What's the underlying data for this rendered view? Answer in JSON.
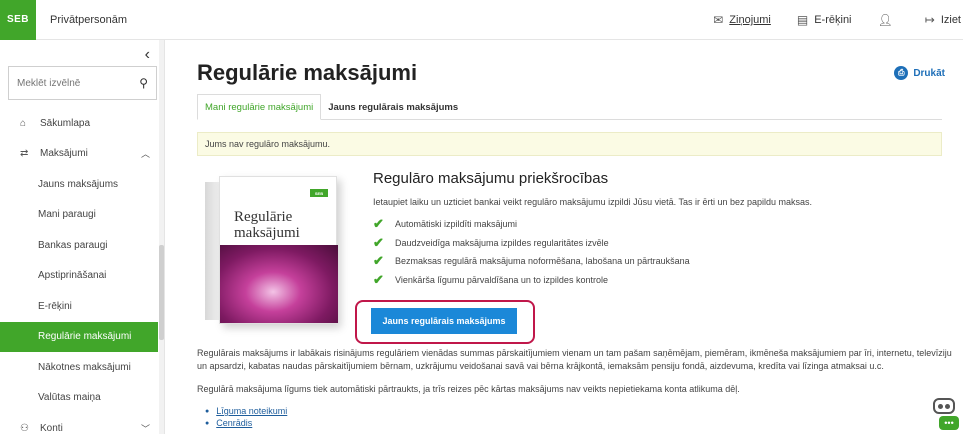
{
  "header": {
    "logo": "SEB",
    "section": "Privātpersonām",
    "messages_label": "Ziņojumi",
    "einvoices_label": "E-rēķini",
    "logout_label": "Iziet"
  },
  "sidebar": {
    "collapse_glyph": "‹",
    "search_placeholder": "Meklēt izvēlnē",
    "items": [
      {
        "label": "Sākumlapa"
      },
      {
        "label": "Maksājumi"
      },
      {
        "label": "Jauns maksājums"
      },
      {
        "label": "Mani paraugi"
      },
      {
        "label": "Bankas paraugi"
      },
      {
        "label": "Apstiprināšanai"
      },
      {
        "label": "E-rēķini"
      },
      {
        "label": "Regulārie maksājumi"
      },
      {
        "label": "Nākotnes maksājumi"
      },
      {
        "label": "Valūtas maiņa"
      },
      {
        "label": "Konti"
      }
    ]
  },
  "main": {
    "title": "Regulārie maksājumi",
    "print_label": "Drukāt",
    "tabs": [
      {
        "label": "Mani regulārie maksājumi"
      },
      {
        "label": "Jauns regulārais maksājums"
      }
    ],
    "notice": "Jums nav regulāro maksājumu.",
    "product_box_title_line1": "Regulārie",
    "product_box_title_line2": "maksājumi",
    "product_box_badge": "SEB",
    "features_title": "Regulāro maksājumu priekšrocības",
    "features_desc": "Ietaupiet laiku un uzticiet bankai veikt regulāro maksājumu izpildi Jūsu vietā. Tas ir ērti un bez papildu maksas.",
    "features": [
      "Automātiski izpildīti maksājumi",
      "Daudzveidīga maksājuma izpildes regularitātes izvēle",
      "Bezmaksas regulārā maksājuma noformēšana, labošana un pārtraukšana",
      "Vienkārša līgumu pārvaldīšana un to izpildes kontrole"
    ],
    "cta_label": "Jauns regulārais maksājums",
    "paragraph1": "Regulārais maksājums ir labākais risinājums regulāriem vienādas summas pārskaitījumiem vienam un tam pašam saņēmējam, piemēram, ikmēneša maksājumiem par īri, internetu, televīziju un apsardzi, kabatas naudas pārskaitījumiem bērnam, uzkrājumu veidošanai savā vai bērna krājkontā, iemaksām pensiju fondā, aizdevuma, kredīta vai līzinga atmaksai u.c.",
    "paragraph2": "Regulārā maksājuma līgums tiek automātiski pārtraukts, ja trīs reizes pēc kārtas maksājums nav veikts nepietiekama konta atlikuma dēļ.",
    "links": [
      {
        "label": "Līguma noteikumi"
      },
      {
        "label": "Cenrādis"
      }
    ]
  },
  "colors": {
    "brand_green": "#41a62a",
    "cta_blue": "#1b88d8",
    "highlight_red": "#c0174a"
  }
}
